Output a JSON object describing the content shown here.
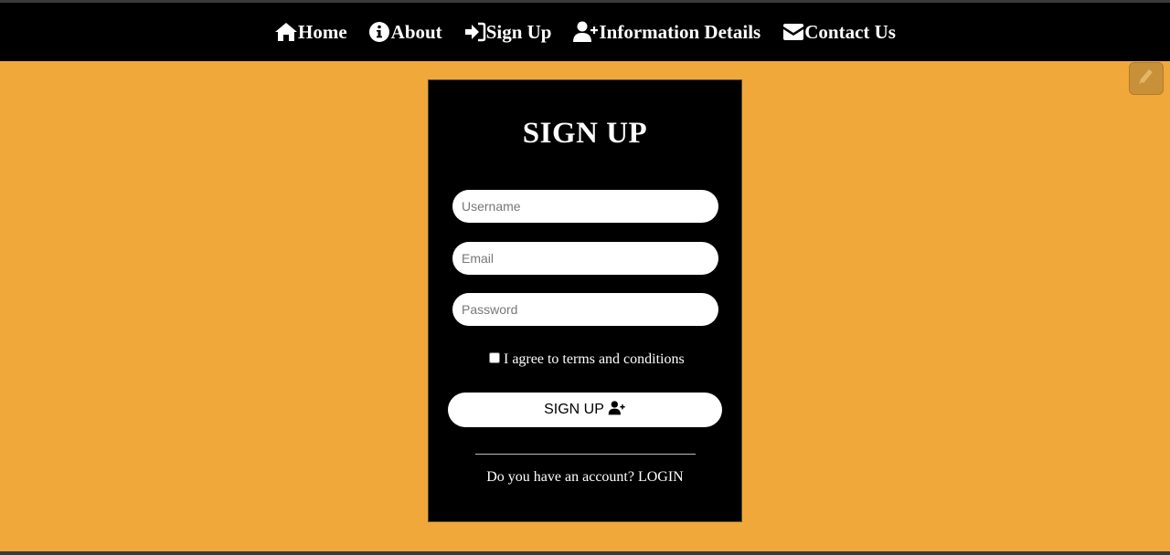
{
  "nav": {
    "items": [
      {
        "label": "Home",
        "icon": "home-icon"
      },
      {
        "label": "About",
        "icon": "info-circle-icon"
      },
      {
        "label": "Sign Up",
        "icon": "sign-in-icon"
      },
      {
        "label": "Information Details",
        "icon": "user-plus-icon"
      },
      {
        "label": "Contact Us",
        "icon": "envelope-icon"
      }
    ]
  },
  "form": {
    "title": "SIGN UP",
    "username_placeholder": "Username",
    "email_placeholder": "Email",
    "password_placeholder": "Password",
    "agree_label": "I agree to terms and conditions",
    "agree_checked": false,
    "submit_label": "SIGN UP",
    "submit_icon": "user-plus-icon",
    "account_prompt": "Do you have an account?",
    "login_label": "LOGIN"
  },
  "colors": {
    "background": "#f1a83a",
    "navbar": "#000000",
    "card": "#000000",
    "text": "#ffffff"
  },
  "corner_button": {
    "icon": "pencil-icon"
  }
}
